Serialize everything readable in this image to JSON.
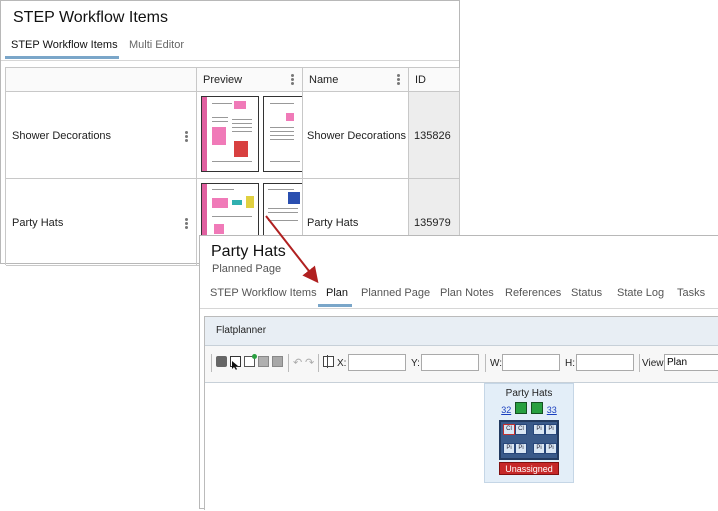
{
  "panel1": {
    "title": "STEP Workflow Items",
    "tabs": [
      {
        "label": "STEP Workflow Items",
        "active": true
      },
      {
        "label": "Multi Editor",
        "active": false
      }
    ],
    "columns": [
      "",
      "Preview",
      "Name",
      "ID"
    ],
    "rows": [
      {
        "label": "Shower Decorations",
        "name": "Shower Decorations",
        "id": "135826"
      },
      {
        "label": "Party Hats",
        "name": "Party Hats",
        "id": "135979"
      }
    ]
  },
  "panel2": {
    "title": "Party Hats",
    "subtitle": "Planned Page",
    "tabs": [
      {
        "label": "STEP Workflow Items",
        "active": false
      },
      {
        "label": "Plan",
        "active": true
      },
      {
        "label": "Planned Page",
        "active": false
      },
      {
        "label": "Plan Notes",
        "active": false
      },
      {
        "label": "References",
        "active": false
      },
      {
        "label": "Status",
        "active": false
      },
      {
        "label": "State Log",
        "active": false
      },
      {
        "label": "Tasks",
        "active": false
      }
    ],
    "flatplanner": {
      "header": "Flatplanner",
      "toolbar": {
        "x_label": "X:",
        "y_label": "Y:",
        "w_label": "W:",
        "h_label": "H:",
        "view_label": "View",
        "view_value": "Plan",
        "icons": [
          "stop-icon",
          "select-pointer-icon",
          "add-page-icon",
          "page-icon",
          "grid-icon",
          "undo-icon",
          "redo-icon",
          "crop-icon"
        ]
      },
      "card": {
        "title": "Party Hats",
        "prev_page": "32",
        "next_page": "33",
        "page_labels": [
          "Cl",
          "Cl",
          "Pi",
          "Pi",
          "Pi",
          "Pi",
          "Pi",
          "Pi"
        ],
        "status": "Unassigned"
      }
    }
  },
  "colors": {
    "accent_underline": "#7aa6c9",
    "status_red": "#c62828",
    "link_blue": "#1a3fbf",
    "arrow_red": "#b02020"
  }
}
